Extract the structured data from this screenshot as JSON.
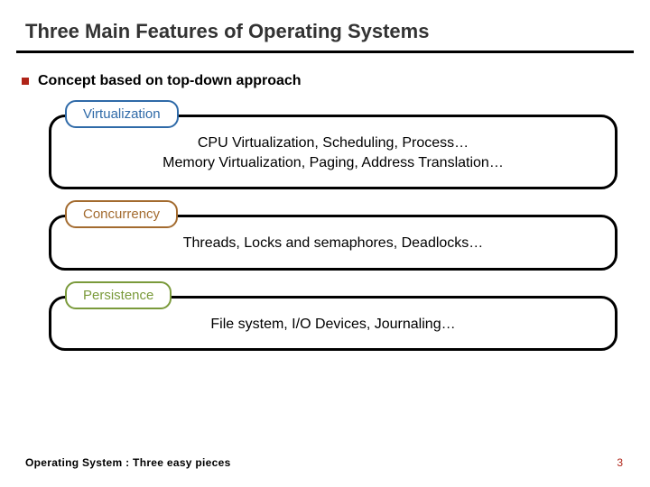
{
  "title": "Three Main Features of Operating Systems",
  "subheading": "Concept based on top-down approach",
  "blocks": {
    "virtualization": {
      "label": "Virtualization",
      "line1": "CPU Virtualization, Scheduling, Process…",
      "line2": "Memory Virtualization, Paging, Address Translation…"
    },
    "concurrency": {
      "label": "Concurrency",
      "line1": "Threads, Locks and semaphores, Deadlocks…"
    },
    "persistence": {
      "label": "Persistence",
      "line1": "File system, I/O Devices, Journaling…"
    }
  },
  "footer": "Operating System : Three easy pieces",
  "page_number": "3"
}
